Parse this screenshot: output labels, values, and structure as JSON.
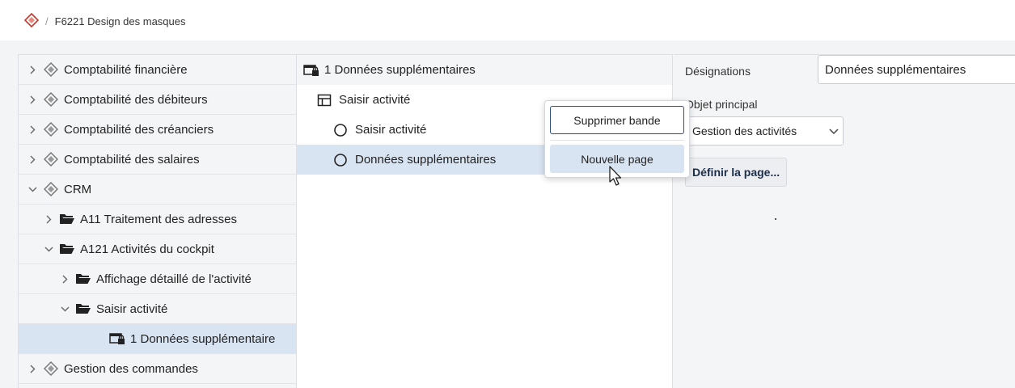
{
  "breadcrumb": {
    "separator": "/",
    "current": "F6221 Design des masques"
  },
  "tree": {
    "items": [
      {
        "label": "Comptabilité financière",
        "level": 0,
        "expanded": false,
        "icon": "module-icon"
      },
      {
        "label": "Comptabilité des débiteurs",
        "level": 0,
        "expanded": false,
        "icon": "module-icon"
      },
      {
        "label": "Comptabilité des créanciers",
        "level": 0,
        "expanded": false,
        "icon": "module-icon"
      },
      {
        "label": "Comptabilité des salaires",
        "level": 0,
        "expanded": false,
        "icon": "module-icon"
      },
      {
        "label": "CRM",
        "level": 0,
        "expanded": true,
        "icon": "module-icon"
      },
      {
        "label": "A11 Traitement des adresses",
        "level": 1,
        "expanded": false,
        "icon": "folder-open-icon"
      },
      {
        "label": "A121 Activités du cockpit",
        "level": 1,
        "expanded": true,
        "icon": "folder-open-icon"
      },
      {
        "label": "Affichage détaillé de l'activité",
        "level": 2,
        "expanded": false,
        "icon": "folder-open-icon"
      },
      {
        "label": "Saisir activité",
        "level": 2,
        "expanded": true,
        "icon": "folder-open-icon"
      },
      {
        "label": "1 Données supplémentaire",
        "level": 3,
        "expanded": null,
        "icon": "locked-form-icon",
        "selected": true
      },
      {
        "label": "Gestion des commandes",
        "level": 0,
        "expanded": false,
        "icon": "module-icon"
      }
    ]
  },
  "structure": {
    "header": "1 Données supplémentaires",
    "rows": [
      {
        "label": "Saisir activité",
        "icon": "layout-icon",
        "indent": 1
      },
      {
        "label": "Saisir activité",
        "icon": "circle-icon",
        "indent": 2
      },
      {
        "label": "Données supplémentaires",
        "icon": "circle-icon",
        "indent": 2,
        "selected": true
      }
    ]
  },
  "props": {
    "designations_label": "Désignations",
    "designations_value": "Données supplémentaires",
    "main_object_label": "Objet principal",
    "main_object_value": "Gestion des activités",
    "define_page_button": "Définir la page..."
  },
  "context_menu": {
    "delete_band": "Supprimer bande",
    "new_page": "Nouvelle page"
  },
  "colors": {
    "accent_border": "#2c4f7c",
    "selection": "#d9e4f2",
    "module_icon": "#c0392b"
  }
}
